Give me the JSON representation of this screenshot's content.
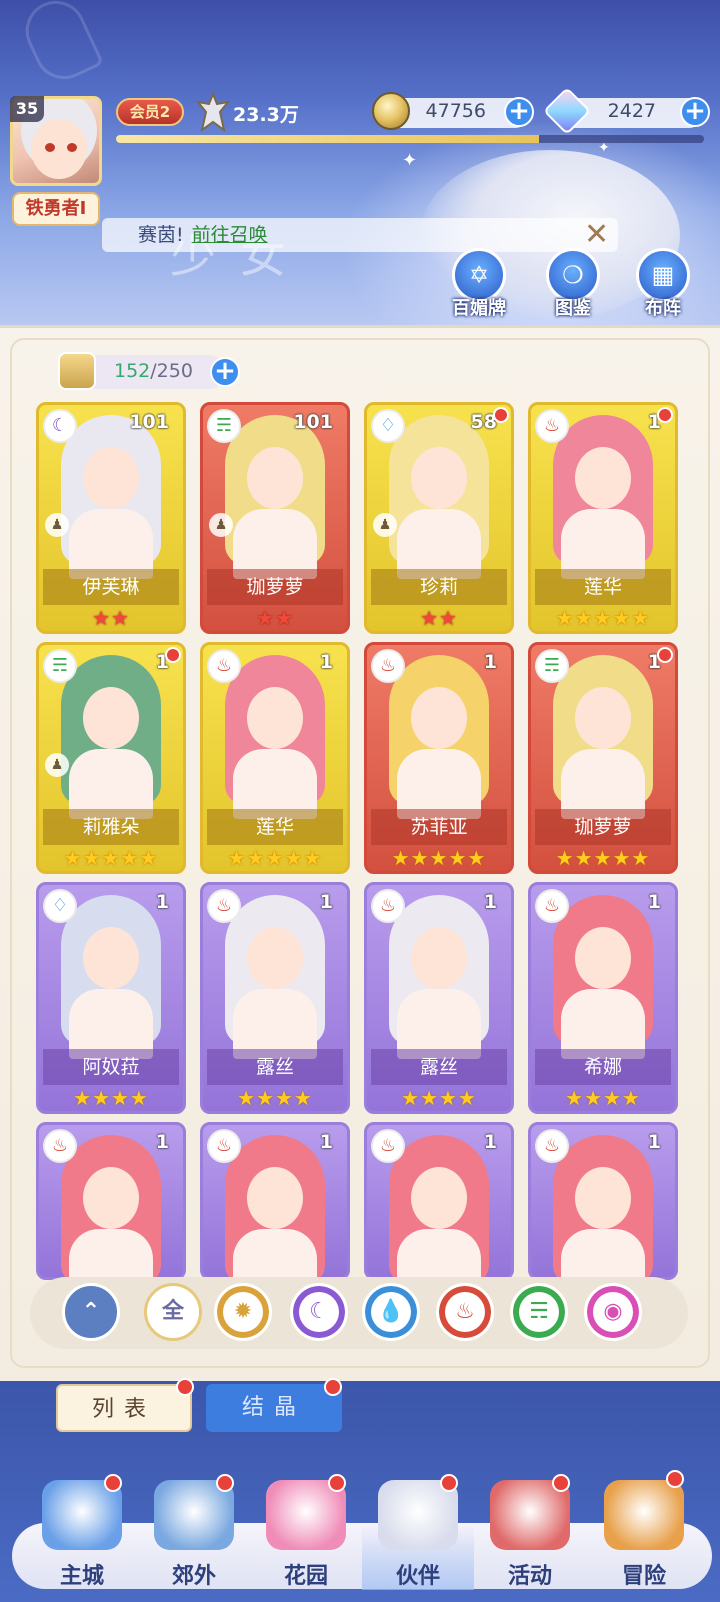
{
  "player": {
    "level": "35",
    "name": "铁勇者I",
    "vip": "会员2",
    "power": "23.3万"
  },
  "resources": {
    "coins": "47756",
    "gems": "2427",
    "exp_progress": 0.72
  },
  "notice": {
    "prefix": "赛茵!",
    "link": "前往召唤",
    "close": "✕"
  },
  "header_title_watermark": "少女",
  "header_buttons": [
    {
      "label": "百媚牌",
      "icon": "card-deck-icon"
    },
    {
      "label": "图鉴",
      "icon": "book-icon"
    },
    {
      "label": "布阵",
      "icon": "grid-formation-icon"
    }
  ],
  "capacity": {
    "current": "152",
    "max": "/250"
  },
  "cards": [
    {
      "name": "伊芙琳",
      "level": "101",
      "element": "moon",
      "rarity": "gold",
      "stars": "★★",
      "star_color": "red",
      "role": true,
      "dot": false,
      "hair": "#e9e8f0"
    },
    {
      "name": "珈萝萝",
      "level": "101",
      "element": "wind",
      "rarity": "red",
      "stars": "★★",
      "star_color": "red",
      "role": true,
      "dot": false,
      "hair": "#f1dc8a"
    },
    {
      "name": "珍莉",
      "level": "58",
      "element": "water",
      "rarity": "gold",
      "stars": "★★",
      "star_color": "red",
      "role": true,
      "dot": true,
      "hair": "#f6e39a"
    },
    {
      "name": "莲华",
      "level": "1",
      "element": "fire",
      "rarity": "gold",
      "stars": "★★★★★",
      "star_color": "gold",
      "role": false,
      "dot": true,
      "hair": "#f0869a"
    },
    {
      "name": "莉雅朵",
      "level": "1",
      "element": "wind",
      "rarity": "gold",
      "stars": "★★★★★",
      "star_color": "gold",
      "role": true,
      "dot": true,
      "hair": "#6fae86"
    },
    {
      "name": "莲华",
      "level": "1",
      "element": "fire",
      "rarity": "gold",
      "stars": "★★★★★",
      "star_color": "gold",
      "role": false,
      "dot": false,
      "hair": "#f0869a"
    },
    {
      "name": "苏菲亚",
      "level": "1",
      "element": "fire",
      "rarity": "red",
      "stars": "★★★★★",
      "star_color": "gold",
      "role": false,
      "dot": false,
      "hair": "#f5d36a"
    },
    {
      "name": "珈萝萝",
      "level": "1",
      "element": "wind",
      "rarity": "red",
      "stars": "★★★★★",
      "star_color": "gold",
      "role": false,
      "dot": true,
      "hair": "#f1dc8a"
    },
    {
      "name": "阿奴菈",
      "level": "1",
      "element": "water",
      "rarity": "purple",
      "stars": "★★★★",
      "star_color": "gold",
      "role": false,
      "dot": false,
      "hair": "#d8dcef"
    },
    {
      "name": "露丝",
      "level": "1",
      "element": "fire",
      "rarity": "purple",
      "stars": "★★★★",
      "star_color": "gold",
      "role": false,
      "dot": false,
      "hair": "#eceaf0"
    },
    {
      "name": "露丝",
      "level": "1",
      "element": "fire",
      "rarity": "purple",
      "stars": "★★★★",
      "star_color": "gold",
      "role": false,
      "dot": false,
      "hair": "#eceaf0"
    },
    {
      "name": "希娜",
      "level": "1",
      "element": "fire",
      "rarity": "purple",
      "stars": "★★★★",
      "star_color": "gold",
      "role": false,
      "dot": false,
      "hair": "#f07a8a"
    },
    {
      "name": "",
      "level": "1",
      "element": "fire",
      "rarity": "purple",
      "stars": "",
      "star_color": "gold",
      "role": false,
      "dot": false,
      "hair": "#f07a8a"
    },
    {
      "name": "",
      "level": "1",
      "element": "fire",
      "rarity": "purple",
      "stars": "",
      "star_color": "gold",
      "role": false,
      "dot": false,
      "hair": "#f07a8a"
    },
    {
      "name": "",
      "level": "1",
      "element": "fire",
      "rarity": "purple",
      "stars": "",
      "star_color": "gold",
      "role": false,
      "dot": false,
      "hair": "#f07a8a"
    },
    {
      "name": "",
      "level": "1",
      "element": "fire",
      "rarity": "purple",
      "stars": "",
      "star_color": "gold",
      "role": false,
      "dot": false,
      "hair": "#f07a8a"
    }
  ],
  "filters": [
    {
      "id": "sort",
      "label": "⌃",
      "icon": "sort-up-icon",
      "color": "#5b7fc0"
    },
    {
      "id": "all",
      "label": "全",
      "icon": "all-filter-icon",
      "color": "#ffffff"
    },
    {
      "id": "light",
      "label": "✹",
      "icon": "sun-icon",
      "color": "#d9a23a"
    },
    {
      "id": "moon",
      "label": "☾",
      "icon": "moon-icon",
      "color": "#8a5ad3"
    },
    {
      "id": "water",
      "label": "💧",
      "icon": "water-drop-icon",
      "color": "#3a8fd8"
    },
    {
      "id": "fire",
      "label": "♨",
      "icon": "fire-icon",
      "color": "#d64b3a"
    },
    {
      "id": "wind",
      "label": "☴",
      "icon": "wind-icon",
      "color": "#3cab4f"
    },
    {
      "id": "arcane",
      "label": "◉",
      "icon": "arcane-orb-icon",
      "color": "#d94fb6"
    }
  ],
  "subtabs": {
    "list": "列表",
    "crystal": "结晶"
  },
  "nav": [
    {
      "label": "主城",
      "icon": "castle-icon",
      "active": false
    },
    {
      "label": "郊外",
      "icon": "portal-icon",
      "active": false
    },
    {
      "label": "花园",
      "icon": "heart-garden-icon",
      "active": false
    },
    {
      "label": "伙伴",
      "icon": "partner-avatar-icon",
      "active": true
    },
    {
      "label": "活动",
      "icon": "gift-box-icon",
      "active": false
    },
    {
      "label": "冒险",
      "icon": "compass-sword-icon",
      "active": false
    }
  ]
}
